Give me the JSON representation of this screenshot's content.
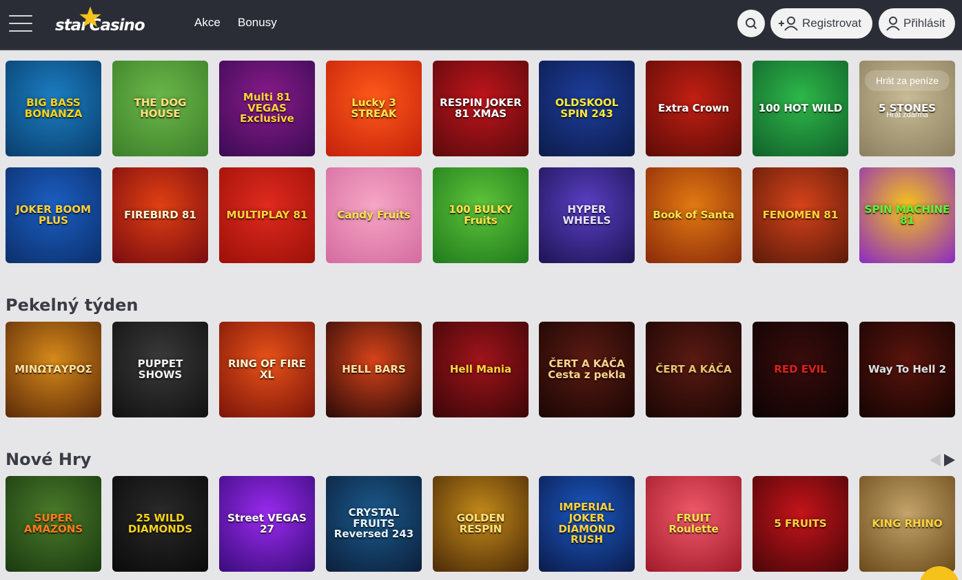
{
  "header": {
    "logo_part1": "star",
    "logo_part2": "Casino",
    "nav": [
      "Akce",
      "Bonusy"
    ],
    "register_label": "Registrovat",
    "login_label": "Přihlásit",
    "icons": {
      "menu": "hamburger-icon",
      "search": "search-icon",
      "register": "add-user-icon",
      "login": "user-icon"
    },
    "colors": {
      "background": "#2b2d36",
      "logo_star": "#f4c21a"
    }
  },
  "top_games": {
    "row1": [
      {
        "name": "BIG BASS BONANZA",
        "colors": [
          "#1b7fc4",
          "#0a3d6b"
        ],
        "text": "#f6d21c"
      },
      {
        "name": "THE DOG HOUSE",
        "colors": [
          "#6cb84a",
          "#3c7f2a"
        ],
        "text": "#ffe07a"
      },
      {
        "name": "Multi 81 VEGAS Exclusive",
        "colors": [
          "#8a1b8c",
          "#3a0b52"
        ],
        "text": "#ffd23a"
      },
      {
        "name": "Lucky 3 STREAK",
        "colors": [
          "#ff5a1a",
          "#c4210b"
        ],
        "text": "#ffe44a"
      },
      {
        "name": "RESPIN JOKER 81 XMAS",
        "colors": [
          "#c0151b",
          "#5a0a0d"
        ],
        "text": "#ffffff"
      },
      {
        "name": "OLDSKOOL SPIN 243",
        "colors": [
          "#1d3e9c",
          "#0c1b4a"
        ],
        "text": "#ffea3a"
      },
      {
        "name": "Extra Crown",
        "colors": [
          "#c21f12",
          "#5c0c08"
        ],
        "text": "#ffffff"
      },
      {
        "name": "100 HOT WILD",
        "colors": [
          "#2eb84a",
          "#11612a"
        ],
        "text": "#ffffff"
      },
      {
        "name": "5 STONES",
        "colors": [
          "#c8bb96",
          "#8c7f5e"
        ],
        "text": "#ffffff",
        "overlay": "Hrát za peníze",
        "overlay_small": "Hrát zdarma"
      }
    ],
    "row2": [
      {
        "name": "JOKER BOOM PLUS",
        "colors": [
          "#1b5fc4",
          "#0c2f6a"
        ],
        "text": "#ffd23a"
      },
      {
        "name": "FIREBIRD 81",
        "colors": [
          "#e04012",
          "#7a0c10"
        ],
        "text": "#fff2d0"
      },
      {
        "name": "MULTIPLAY 81",
        "colors": [
          "#e02a1f",
          "#9c1008"
        ],
        "text": "#ffd23a"
      },
      {
        "name": "Candy Fruits",
        "colors": [
          "#f6a6c4",
          "#d46ba0"
        ],
        "text": "#ffe14a"
      },
      {
        "name": "100 BULKY Fruits",
        "colors": [
          "#5fc43a",
          "#1f7a1c"
        ],
        "text": "#ffe14a"
      },
      {
        "name": "HYPER WHEELS",
        "colors": [
          "#5a3fc4",
          "#1d1452"
        ],
        "text": "#e6e0ff"
      },
      {
        "name": "Book of Santa",
        "colors": [
          "#e27a12",
          "#8a2a0a"
        ],
        "text": "#ffe14a"
      },
      {
        "name": "FENOMEN 81",
        "colors": [
          "#d6431a",
          "#5c1a0a"
        ],
        "text": "#ffd23a"
      },
      {
        "name": "SPIN MACHINE 81",
        "colors": [
          "#f6c21a",
          "#8a2ac4"
        ],
        "text": "#5ef23a"
      }
    ]
  },
  "sections": [
    {
      "title": "Pekelný týden",
      "games": [
        {
          "name": "ΜΙΝΩΤΑΥΡΟΣ",
          "colors": [
            "#d68a1a",
            "#5c2a08"
          ],
          "text": "#ffe0a0"
        },
        {
          "name": "PUPPET SHOWS",
          "colors": [
            "#3a3a3a",
            "#111111"
          ],
          "text": "#f2f2f2"
        },
        {
          "name": "RING OF FIRE XL",
          "colors": [
            "#e8521a",
            "#7a1408"
          ],
          "text": "#fff2d0"
        },
        {
          "name": "HELL BARS",
          "colors": [
            "#d6431a",
            "#2a0a08"
          ],
          "text": "#ffe0a0"
        },
        {
          "name": "Hell Mania",
          "colors": [
            "#a0141a",
            "#3a0608"
          ],
          "text": "#ffd23a"
        },
        {
          "name": "ČERT A KÁČA Cesta z pekla",
          "colors": [
            "#5a1a12",
            "#1a0604"
          ],
          "text": "#ffd28a"
        },
        {
          "name": "ČERT A KÁČA",
          "colors": [
            "#5a1a12",
            "#1a0604"
          ],
          "text": "#e8c070"
        },
        {
          "name": "RED EVIL",
          "colors": [
            "#3a0c0c",
            "#0d0303"
          ],
          "text": "#e0201a"
        },
        {
          "name": "Way To Hell 2",
          "colors": [
            "#5a140c",
            "#150403"
          ],
          "text": "#e0e0e0"
        }
      ]
    },
    {
      "title": "Nové Hry",
      "games": [
        {
          "name": "SUPER AMAZONS",
          "colors": [
            "#4a7a2a",
            "#1a3a10"
          ],
          "text": "#ff7a1a"
        },
        {
          "name": "25 WILD DIAMONDS",
          "colors": [
            "#2a2a2a",
            "#0a0a0a"
          ],
          "text": "#f6d21c"
        },
        {
          "name": "Street VEGAS 27",
          "colors": [
            "#9a2af0",
            "#3a0c7a"
          ],
          "text": "#ffffff"
        },
        {
          "name": "CRYSTAL FRUITS Reversed 243",
          "colors": [
            "#1a5a8c",
            "#0c1f3a"
          ],
          "text": "#e6f4ff"
        },
        {
          "name": "GOLDEN RESPIN",
          "colors": [
            "#c48a1a",
            "#4a2a08"
          ],
          "text": "#ffe07a"
        },
        {
          "name": "IMPERIAL JOKER DIAMOND RUSH",
          "colors": [
            "#1a5ac4",
            "#0c1a4a"
          ],
          "text": "#ffd23a"
        },
        {
          "name": "FRUIT Roulette",
          "colors": [
            "#f05a6a",
            "#a01a2a"
          ],
          "text": "#ffe14a"
        },
        {
          "name": "5 FRUITS",
          "colors": [
            "#c4141a",
            "#4a0608"
          ],
          "text": "#ffd23a"
        },
        {
          "name": "KING RHINO",
          "colors": [
            "#c4a46a",
            "#6a4a1a"
          ],
          "text": "#ffd23a"
        }
      ]
    }
  ]
}
